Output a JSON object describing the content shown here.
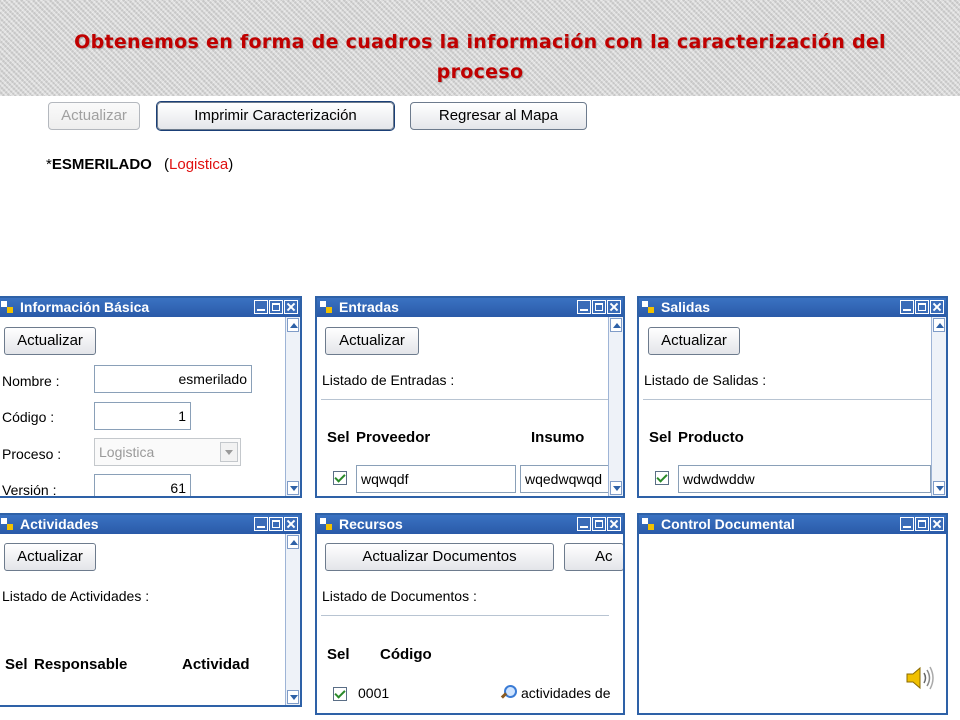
{
  "slide": {
    "title_line1": "Obtenemos en forma de cuadros la información con la caracterización del",
    "title_line2": "proceso"
  },
  "toolbar": {
    "update_label": "Actualizar",
    "print_label": "Imprimir Caracterización",
    "back_label": "Regresar al Mapa"
  },
  "process": {
    "marker": "*",
    "name": "ESMERILADO",
    "open_paren": "(",
    "category": "Logistica",
    "close_paren": ")"
  },
  "panels": {
    "basic": {
      "title": "Información Básica",
      "update_label": "Actualizar",
      "name_label": "Nombre :",
      "name_value": "esmerilado",
      "code_label": "Código :",
      "code_value": "1",
      "process_label": "Proceso :",
      "process_value": "Logistica",
      "version_label": "Versión :",
      "version_value": "61"
    },
    "inputs": {
      "title": "Entradas",
      "update_label": "Actualizar",
      "list_label": "Listado de Entradas :",
      "columns": [
        "Sel",
        "Proveedor",
        "Insumo"
      ],
      "row": {
        "proveedor": "wqwqdf",
        "insumo": "wqedwqwqd"
      }
    },
    "outputs": {
      "title": "Salidas",
      "update_label": "Actualizar",
      "list_label": "Listado de Salidas :",
      "columns": [
        "Sel",
        "Producto"
      ],
      "row": {
        "producto": "wdwdwddw"
      }
    },
    "activities": {
      "title": "Actividades",
      "update_label": "Actualizar",
      "list_label": "Listado de Actividades :",
      "columns": [
        "Sel",
        "Responsable",
        "Actividad"
      ]
    },
    "resources": {
      "title": "Recursos",
      "update_docs_label": "Actualizar Documentos",
      "second_button_label": "Ac",
      "list_label": "Listado de Documentos :",
      "columns": [
        "Sel",
        "Código"
      ],
      "row": {
        "codigo": "0001",
        "documento": "actividades de"
      }
    },
    "control": {
      "title": "Control Documental"
    }
  },
  "colors": {
    "title_red": "#c00000",
    "panel_blue": "#2e61a7",
    "category_red": "#e01010"
  },
  "icons": [
    "window-icon",
    "minimize-icon",
    "maximize-icon",
    "close-icon",
    "scroll-up-icon",
    "scroll-down-icon",
    "checkbox-icon",
    "magnifier-icon",
    "speaker-icon"
  ]
}
